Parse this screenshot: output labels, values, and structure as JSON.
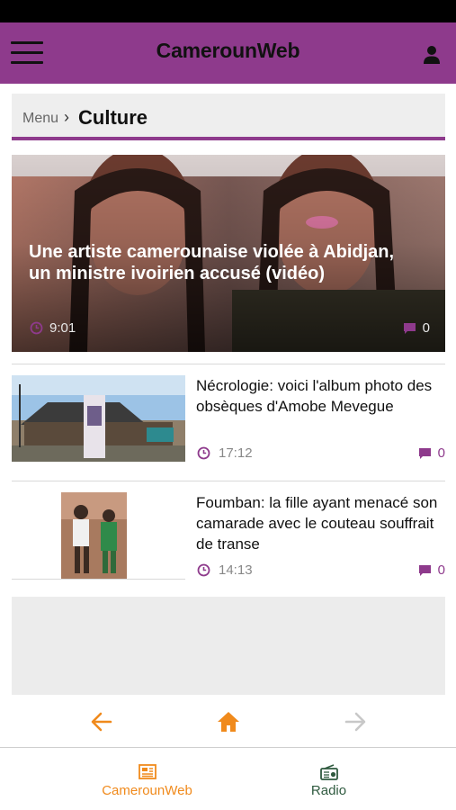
{
  "app": {
    "title": "CamerounWeb"
  },
  "breadcrumb": {
    "root": "Menu",
    "separator": "›",
    "current": "Culture"
  },
  "featured": {
    "title": "Une artiste camerounaise violée à Abidjan, un ministre ivoirien accusé (vidéo)",
    "time": "9:01",
    "comments": "0"
  },
  "articles": [
    {
      "title": "Nécrologie: voici l'album photo des obsèques d'Amobe Mevegue",
      "time": "17:12",
      "comments": "0"
    },
    {
      "title": "Foumban: la fille ayant menacé son camarade avec le couteau souffrait de transe",
      "time": "14:13",
      "comments": "0"
    }
  ],
  "tabs": [
    {
      "label": "CamerounWeb",
      "icon": "newspaper-icon",
      "active": true
    },
    {
      "label": "Radio",
      "icon": "radio-icon",
      "active": false
    }
  ],
  "colors": {
    "brand": "#8e3a8c",
    "accent": "#f08a1c",
    "tab_inactive": "#2f5a3f"
  }
}
